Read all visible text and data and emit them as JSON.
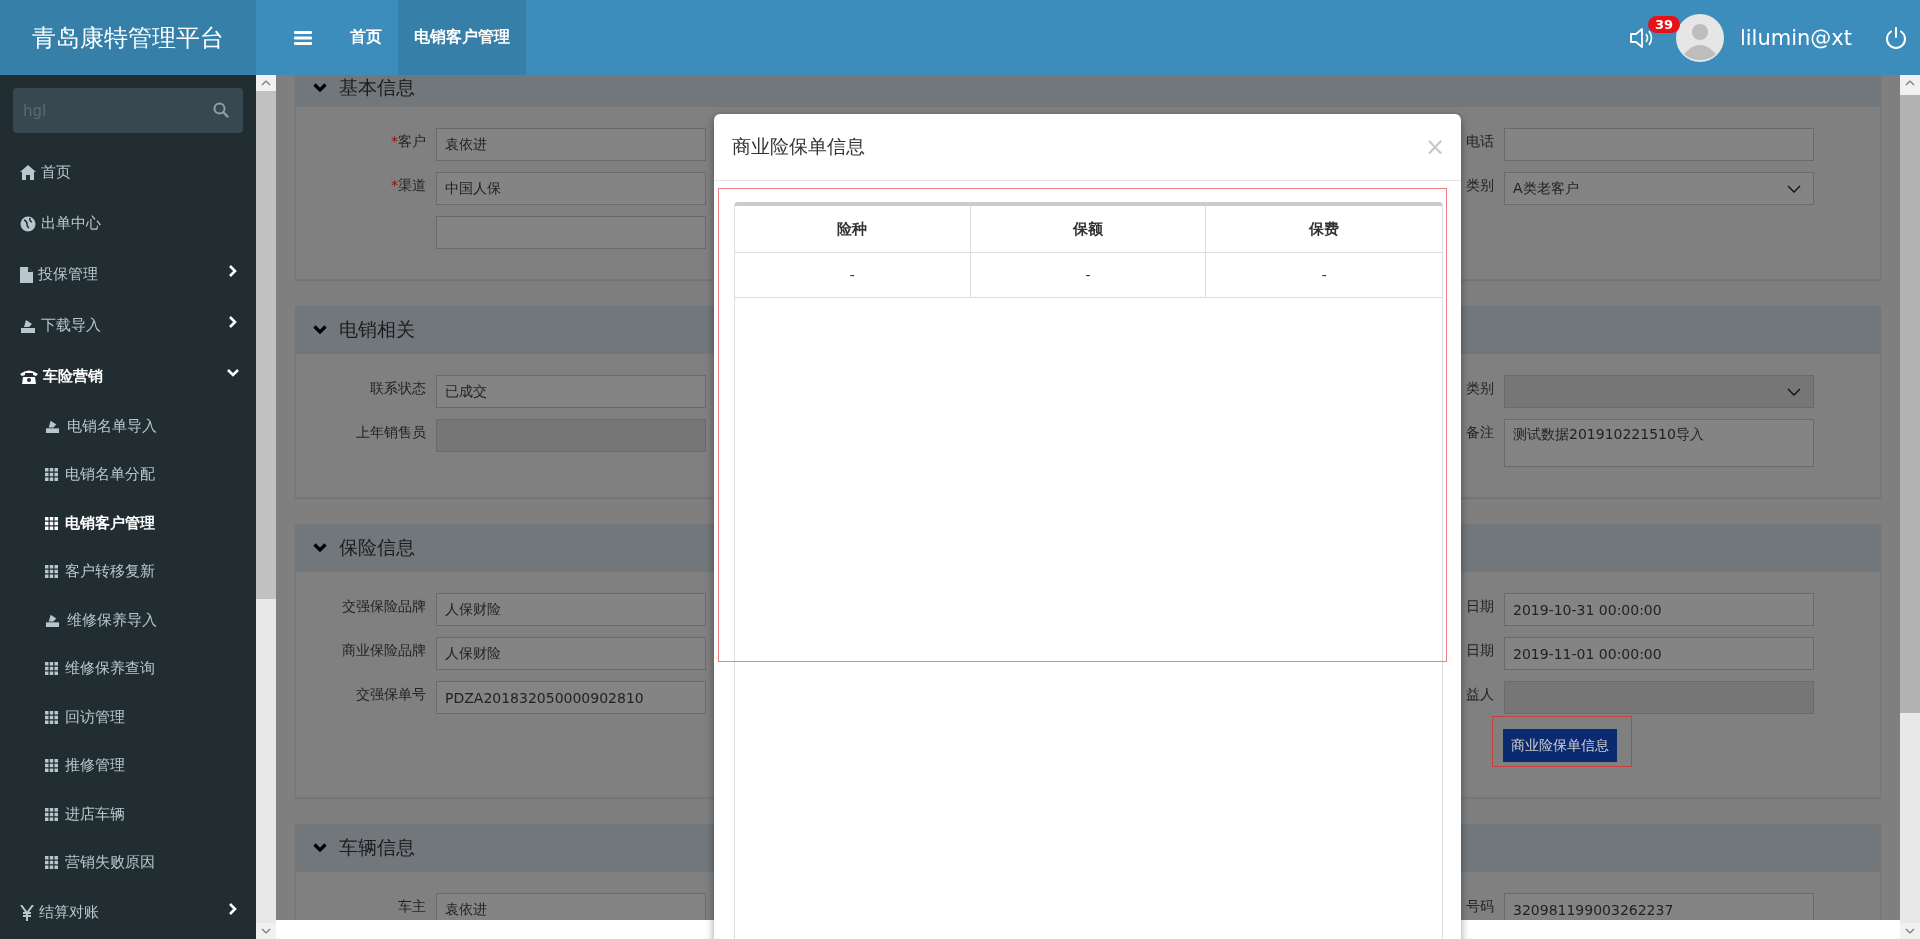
{
  "app": {
    "title": "青岛康特管理平台"
  },
  "topnav": [
    {
      "label": "首页",
      "selected": false
    },
    {
      "label": "电销客户管理",
      "selected": true
    }
  ],
  "notifications": {
    "count": "39"
  },
  "user": {
    "name": "lilumin@xt"
  },
  "sidebar": {
    "search": {
      "placeholder": "hgl"
    },
    "items": [
      {
        "label": "首页",
        "kind": "home",
        "expandable": false,
        "expanded": false
      },
      {
        "label": "出单中心",
        "kind": "globe",
        "expandable": false,
        "expanded": false
      },
      {
        "label": "投保管理",
        "kind": "file",
        "expandable": true,
        "expanded": false
      },
      {
        "label": "下载导入",
        "kind": "upload",
        "expandable": true,
        "expanded": false
      },
      {
        "label": "车险营销",
        "kind": "phone",
        "expandable": true,
        "expanded": true,
        "children": [
          {
            "label": "电销名单导入",
            "kind": "upload",
            "selected": false
          },
          {
            "label": "电销名单分配",
            "kind": "grid",
            "selected": false
          },
          {
            "label": "电销客户管理",
            "kind": "grid",
            "selected": true
          },
          {
            "label": "客户转移复新",
            "kind": "grid",
            "selected": false
          },
          {
            "label": "维修保养导入",
            "kind": "upload",
            "selected": false
          },
          {
            "label": "维修保养查询",
            "kind": "grid",
            "selected": false
          },
          {
            "label": "回访管理",
            "kind": "grid",
            "selected": false
          },
          {
            "label": "推修管理",
            "kind": "grid",
            "selected": false
          },
          {
            "label": "进店车辆",
            "kind": "grid",
            "selected": false
          },
          {
            "label": "营销失败原因",
            "kind": "grid",
            "selected": false
          }
        ]
      },
      {
        "label": "结算对账",
        "kind": "yen",
        "expandable": true,
        "expanded": false
      }
    ]
  },
  "sections": [
    {
      "title": "基本信息",
      "expanded": true,
      "rows": [
        {
          "left": {
            "kind": "text",
            "label": "客户",
            "mark": "*",
            "value": "袁依进",
            "disabled": false
          },
          "right": {
            "kind": "text",
            "label": "电话",
            "disabled": false
          }
        },
        {
          "left": {
            "kind": "text",
            "label": "渠道",
            "mark": "*",
            "value": "中国人保",
            "disabled": false
          },
          "right": {
            "kind": "select",
            "label": "类别",
            "value": "A类老客户",
            "disabled": false
          }
        },
        {
          "left": {
            "kind": "text",
            "disabled": false
          }
        }
      ]
    },
    {
      "title": "电销相关",
      "expanded": true,
      "rows": [
        {
          "left": {
            "kind": "text",
            "label": "联系状态",
            "value": "已成交",
            "disabled": false
          },
          "right": {
            "kind": "select",
            "label": "类别",
            "disabled": true
          }
        },
        {
          "left": {
            "kind": "text",
            "label": "上年销售员",
            "disabled": true
          },
          "right": {
            "kind": "textarea",
            "label": "备注",
            "value": "测试数据201910221510导入",
            "disabled": false
          }
        }
      ]
    },
    {
      "title": "保险信息",
      "expanded": true,
      "rows": [
        {
          "left": {
            "kind": "text",
            "label": "交强保险品牌",
            "value": "人保财险",
            "disabled": false
          },
          "right": {
            "kind": "text",
            "label": "日期",
            "value": "2019-10-31 00:00:00",
            "disabled": false
          }
        },
        {
          "left": {
            "kind": "text",
            "label": "商业保险品牌",
            "value": "人保财险",
            "disabled": false
          },
          "right": {
            "kind": "text",
            "label": "日期",
            "value": "2019-11-01 00:00:00",
            "disabled": false
          }
        },
        {
          "left": {
            "kind": "text",
            "label": "交强保单号",
            "value": "PDZA201832050000902810",
            "disabled": false
          },
          "right": {
            "kind": "text",
            "label": "益人",
            "disabled": true
          }
        },
        {
          "right": {
            "kind": "button",
            "label": "商业险保单信息",
            "highlighted": true
          }
        }
      ]
    },
    {
      "title": "车辆信息",
      "expanded": true,
      "rows": [
        {
          "left": {
            "kind": "text",
            "label": "车主",
            "value": "袁依进",
            "disabled": false
          },
          "right": {
            "kind": "text",
            "label": "号码",
            "value": "320981199003262237",
            "disabled": false
          }
        }
      ]
    }
  ],
  "modal": {
    "title": "商业险保单信息",
    "close": "×",
    "highlighted": true,
    "table": {
      "columns": [
        "险种",
        "保额",
        "保费"
      ],
      "rows": [
        [
          "-",
          "-",
          "-"
        ]
      ]
    }
  }
}
